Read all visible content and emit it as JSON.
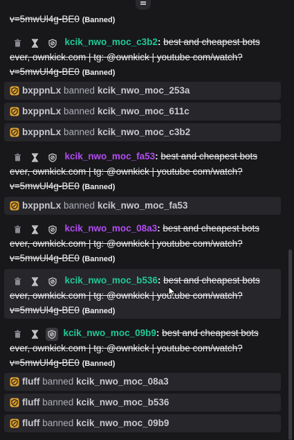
{
  "colors": {
    "teal": "#20c997",
    "purple": "#b24df0",
    "mod_badge": "#e0a22e"
  },
  "messages": [
    {
      "partial": true,
      "text_line": "v=5mwUl4g-BE0",
      "banned_label": "(Banned)"
    },
    {
      "user": "kcik_nwo_moc_c3b2",
      "user_color": "teal",
      "colon": ":",
      "text": "best and cheapest bots ever, ownkick.com | tg: @ownkick | youtube com/watch?v=5mwUl4g-BE0",
      "banned_label": "(Banned)"
    },
    {
      "user": "kcik_nwo_moc_fa53",
      "user_color": "purple",
      "colon": ":",
      "text": "best and cheapest bots ever, ownkick.com | tg: @ownkick | youtube com/watch?v=5mwUl4g-BE0",
      "banned_label": "(Banned)"
    },
    {
      "user": "kcik_nwo_moc_08a3",
      "user_color": "purple",
      "colon": ":",
      "text": "best and cheapest bots ever, ownkick.com | tg: @ownkick | youtube com/watch?v=5mwUl4g-BE0",
      "banned_label": "(Banned)"
    },
    {
      "user": "kcik_nwo_moc_b536",
      "user_color": "teal",
      "colon": ":",
      "text": "best and cheapest bots ever, ownkick.com | tg: @ownkick | youtube com/watch?v=5mwUl4g-BE0",
      "banned_label": "(Banned)"
    },
    {
      "user": "kcik_nwo_moc_09b9",
      "user_color": "teal",
      "colon": ":",
      "text": "best and cheapest bots ever, ownkick.com | tg: @ownkick | youtube com/watch?v=5mwUl4g-BE0",
      "banned_label": "(Banned)"
    }
  ],
  "ban_notices": [
    {
      "moderator": "bxppnLx",
      "action": "banned",
      "target": "kcik_nwo_moc_253a"
    },
    {
      "moderator": "bxppnLx",
      "action": "banned",
      "target": "kcik_nwo_moc_611c"
    },
    {
      "moderator": "bxppnLx",
      "action": "banned",
      "target": "kcik_nwo_moc_c3b2"
    },
    {
      "moderator": "bxppnLx",
      "action": "banned",
      "target": "kcik_nwo_moc_fa53"
    },
    {
      "moderator": "fluff",
      "action": "banned",
      "target": "kcik_nwo_moc_08a3"
    },
    {
      "moderator": "fluff",
      "action": "banned",
      "target": "kcik_nwo_moc_b536"
    },
    {
      "moderator": "fluff",
      "action": "banned",
      "target": "kcik_nwo_moc_09b9"
    }
  ],
  "icons": {
    "delete": "trash-icon",
    "timeout": "hourglass-icon",
    "ban": "shield-ban-icon",
    "moderator_badge": "mod-badge-icon",
    "scroll_up": "chevron-up-icon"
  }
}
